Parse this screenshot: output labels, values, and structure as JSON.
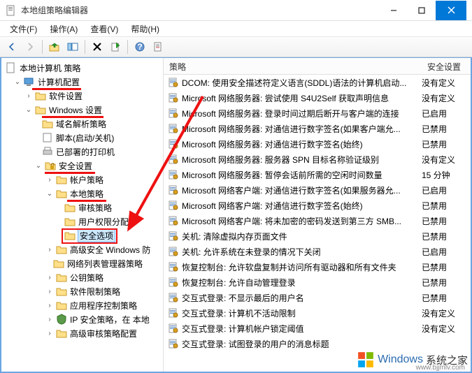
{
  "window": {
    "title": "本地组策略编辑器"
  },
  "menus": {
    "file": "文件(F)",
    "action": "操作(A)",
    "view": "查看(V)",
    "help": "帮助(H)"
  },
  "columns": {
    "policy": "策略",
    "setting": "安全设置"
  },
  "tree": {
    "root": "本地计算机 策略",
    "n1": "计算机配置",
    "n1_1": "软件设置",
    "n1_2": "Windows 设置",
    "n1_2_1": "域名解析策略",
    "n1_2_2": "脚本(启动/关机)",
    "n1_2_3": "已部署的打印机",
    "n1_2_4": "安全设置",
    "n1_2_4_1": "帐户策略",
    "n1_2_4_2": "本地策略",
    "n1_2_4_2_1": "审核策略",
    "n1_2_4_2_2": "用户权限分配",
    "n1_2_4_2_3": "安全选项",
    "n1_2_4_3": "高级安全 Windows 防",
    "n1_2_4_4": "网络列表管理器策略",
    "n1_2_4_5": "公钥策略",
    "n1_2_4_6": "软件限制策略",
    "n1_2_4_7": "应用程序控制策略",
    "n1_2_4_8": "IP 安全策略，在 本地",
    "n1_2_4_9": "高级审核策略配置"
  },
  "policies": [
    {
      "name": "DCOM: 使用安全描述符定义语言(SDDL)语法的计算机启动...",
      "value": "没有定义"
    },
    {
      "name": "Microsoft 网络服务器: 尝试使用 S4U2Self 获取声明信息",
      "value": "没有定义"
    },
    {
      "name": "Microsoft 网络服务器: 登录时间过期后断开与客户端的连接",
      "value": "已启用"
    },
    {
      "name": "Microsoft 网络服务器: 对通信进行数字签名(如果客户端允...",
      "value": "已禁用"
    },
    {
      "name": "Microsoft 网络服务器: 对通信进行数字签名(始终)",
      "value": "已禁用"
    },
    {
      "name": "Microsoft 网络服务器: 服务器 SPN 目标名称验证级别",
      "value": "没有定义"
    },
    {
      "name": "Microsoft 网络服务器: 暂停会话前所需的空闲时间数量",
      "value": "15 分钟"
    },
    {
      "name": "Microsoft 网络客户端: 对通信进行数字签名(如果服务器允...",
      "value": "已启用"
    },
    {
      "name": "Microsoft 网络客户端: 对通信进行数字签名(始终)",
      "value": "已禁用"
    },
    {
      "name": "Microsoft 网络客户端: 将未加密的密码发送到第三方 SMB...",
      "value": "已禁用"
    },
    {
      "name": "关机: 清除虚拟内存页面文件",
      "value": "已禁用"
    },
    {
      "name": "关机: 允许系统在未登录的情况下关闭",
      "value": "已启用"
    },
    {
      "name": "恢复控制台: 允许软盘复制并访问所有驱动器和所有文件夹",
      "value": "已禁用"
    },
    {
      "name": "恢复控制台: 允许自动管理登录",
      "value": "已禁用"
    },
    {
      "name": "交互式登录: 不显示最后的用户名",
      "value": "已禁用"
    },
    {
      "name": "交互式登录: 计算机不活动限制",
      "value": "没有定义"
    },
    {
      "name": "交互式登录: 计算机帐户锁定阈值",
      "value": "没有定义"
    },
    {
      "name": "交互式登录: 试图登录的用户的消息标题",
      "value": ""
    }
  ],
  "watermark": {
    "brand": "Windows",
    "suffix": "系统之家",
    "url": "www.bjjmlv.com"
  }
}
